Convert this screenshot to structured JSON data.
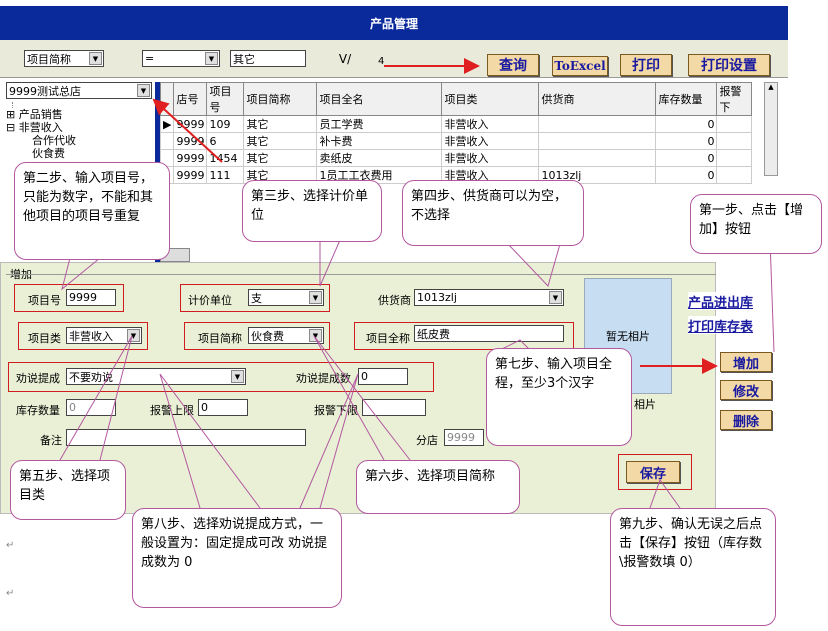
{
  "title": "产品管理",
  "search": {
    "field": "项目简称",
    "op": "=",
    "value": "其它",
    "v_btn": "V/",
    "four": "4",
    "query_btn": "查询",
    "excel_btn": "ToExcel",
    "print_btn": "打印",
    "print_setup_btn": "打印设置"
  },
  "store_select": "9999测试总店",
  "tree": {
    "item1": "产品销售",
    "item2": "非营收入",
    "child1": "合作代收",
    "child2": "伙食费"
  },
  "grid": {
    "headers": [
      "店号",
      "项目号",
      "项目简称",
      "项目全名",
      "项目类",
      "供货商",
      "库存数量",
      "报警下"
    ],
    "rows": [
      [
        "9999",
        "109",
        "其它",
        "员工学费",
        "非营收入",
        "",
        "0",
        ""
      ],
      [
        "9999",
        "6",
        "其它",
        "补卡费",
        "非营收入",
        "",
        "0",
        ""
      ],
      [
        "9999",
        "1454",
        "其它",
        "卖纸皮",
        "非营收入",
        "",
        "0",
        ""
      ],
      [
        "9999",
        "111",
        "其它",
        "1员工工衣费用",
        "非营收入",
        "1013zlj",
        "0",
        ""
      ]
    ]
  },
  "form": {
    "section": "增加",
    "item_no_label": "项目号",
    "item_no": "9999",
    "unit_label": "计价单位",
    "unit": "支",
    "supplier_label": "供货商",
    "supplier": "1013zlj",
    "type_label": "项目类",
    "type": "非营收入",
    "short_label": "项目简称",
    "short": "伙食费",
    "full_label": "项目全称",
    "full": "纸皮费",
    "photo": "暂无相片",
    "photo2": "相片",
    "commission_label": "劝说提成",
    "commission": "不要劝说",
    "commission_num_label": "劝说提成数",
    "commission_num": "0",
    "stock_label": "库存数量",
    "stock": "0",
    "alarm_up_label": "报警上限",
    "alarm_up": "0",
    "alarm_down_label": "报警下限",
    "alarm_down": "",
    "remark_label": "备注",
    "branch_label": "分店",
    "branch": "9999",
    "save_btn": "保存"
  },
  "side": {
    "link1": "产品进出库",
    "link2": "打印库存表",
    "add": "增加",
    "edit": "修改",
    "del": "删除"
  },
  "callouts": {
    "c1": "第一步、点击【增加】按钮",
    "c2": "第二步、输入项目号，只能为数字，不能和其他项目的项目号重复",
    "c3": "第三步、选择计价单位",
    "c4": "第四步、供货商可以为空，不选择",
    "c5": "第五步、选择项目类",
    "c6": "第六步、选择项目简称",
    "c7": "第七步、输入项目全程，至少3个汉字",
    "c8": "第八步、选择劝说提成方式，一般设置为：固定提成可改  劝说提成数为 0",
    "c9": "第九步、确认无误之后点击【保存】按钮（库存数\\报警数填 0）"
  }
}
